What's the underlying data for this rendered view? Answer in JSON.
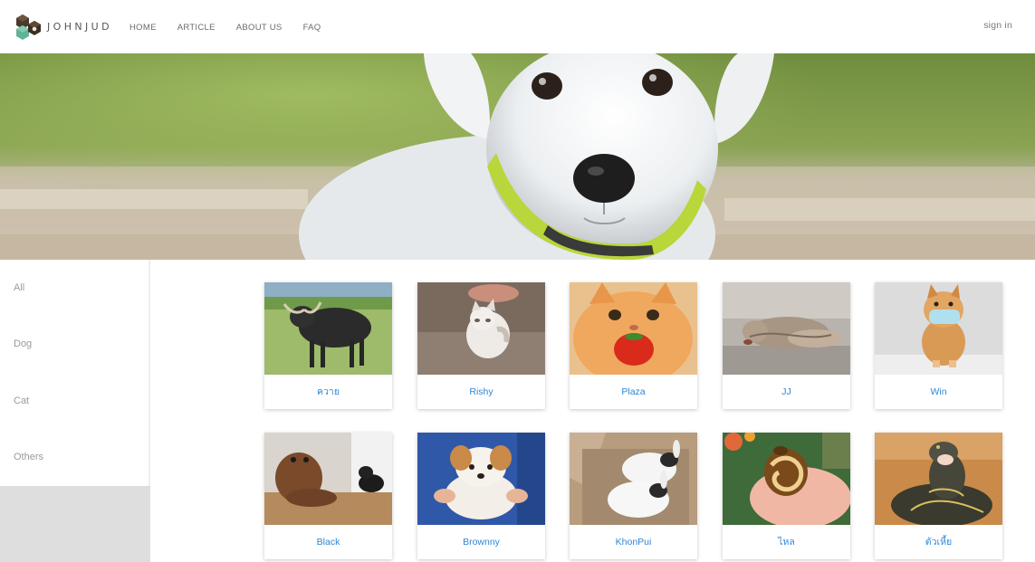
{
  "header": {
    "brand": "JOHNJUD",
    "nav": [
      "HOME",
      "ARTICLE",
      "ABOUT US",
      "FAQ"
    ],
    "sign_in": "sign in"
  },
  "sidebar": {
    "categories": [
      "All",
      "Dog",
      "Cat",
      "Others"
    ]
  },
  "pets": [
    {
      "name": "ควาย",
      "photo": "water-buffalo-photo"
    },
    {
      "name": "Rishy",
      "photo": "kitten-photo"
    },
    {
      "name": "Plaza",
      "photo": "orange-cat-photo"
    },
    {
      "name": "JJ",
      "photo": "tabby-cat-photo"
    },
    {
      "name": "Win",
      "photo": "pomeranian-dog-photo"
    },
    {
      "name": "Black",
      "photo": "poodle-dog-photo"
    },
    {
      "name": "Brownny",
      "photo": "puppy-photo"
    },
    {
      "name": "KhonPui",
      "photo": "rabbit-photo"
    },
    {
      "name": "ไหล",
      "photo": "snake-photo"
    },
    {
      "name": "ตัวเหี้ย",
      "photo": "monitor-lizard-photo"
    }
  ],
  "colors": {
    "link": "#2f86d6",
    "sidebar_fill": "#dedede",
    "text_muted": "#9a9a9a"
  }
}
